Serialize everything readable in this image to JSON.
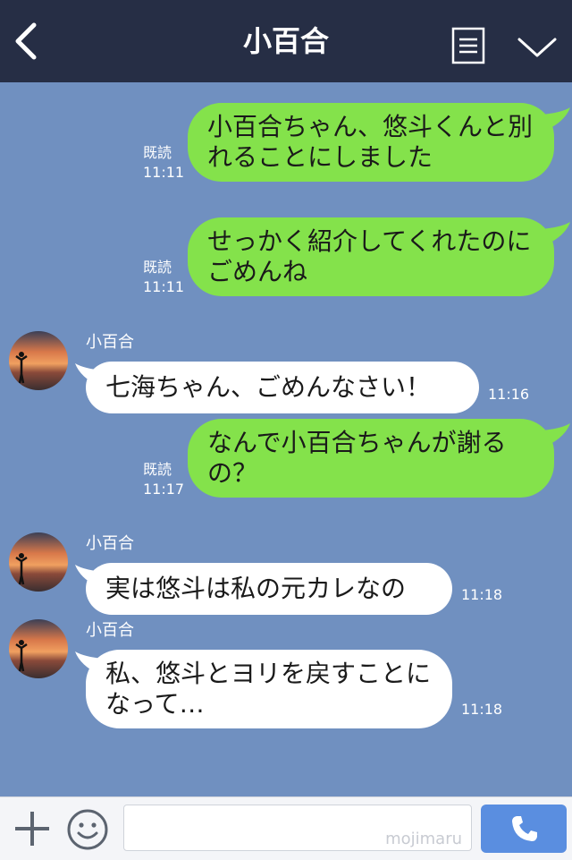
{
  "header": {
    "title": "小百合"
  },
  "messages": [
    {
      "direction": "out",
      "text": "小百合ちゃん、悠斗くんと別れることにしました",
      "read": "既読",
      "time": "11:11"
    },
    {
      "direction": "out",
      "text": "せっかく紹介してくれたのにごめんね",
      "read": "既読",
      "time": "11:11"
    },
    {
      "direction": "in",
      "sender": "小百合",
      "text": "七海ちゃん、ごめんなさい！",
      "time": "11:16"
    },
    {
      "direction": "out",
      "text": "なんで小百合ちゃんが謝るの？",
      "read": "既読",
      "time": "11:17"
    },
    {
      "direction": "in",
      "sender": "小百合",
      "text": "実は悠斗は私の元カレなの",
      "time": "11:18"
    },
    {
      "direction": "in",
      "sender": "小百合",
      "text": "私、悠斗とヨリを戻すことになって…",
      "time": "11:18"
    }
  ],
  "input": {
    "watermark": "mojimaru"
  },
  "icons": {
    "back": "chevron-left-icon",
    "menu": "list-icon",
    "collapse": "chevron-down-icon",
    "add": "plus-icon",
    "emoji": "smiley-icon",
    "call": "phone-icon"
  },
  "colors": {
    "header_bg": "#262e45",
    "chat_bg": "#7090c0",
    "outgoing_bubble": "#84e24b",
    "incoming_bubble": "#ffffff",
    "call_button": "#5a8ee0"
  }
}
